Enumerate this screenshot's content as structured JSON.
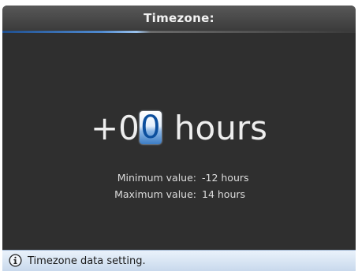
{
  "window": {
    "title": "Timezone:"
  },
  "editor": {
    "prefix": "+0",
    "cursor_digit": "0",
    "unit": "hours"
  },
  "limits": {
    "min_label": "Minimum value:",
    "min_value": "-12 hours",
    "max_label": "Maximum value:",
    "max_value": "14 hours"
  },
  "status": {
    "icon": "info-icon",
    "text": "Timezone data setting."
  }
}
